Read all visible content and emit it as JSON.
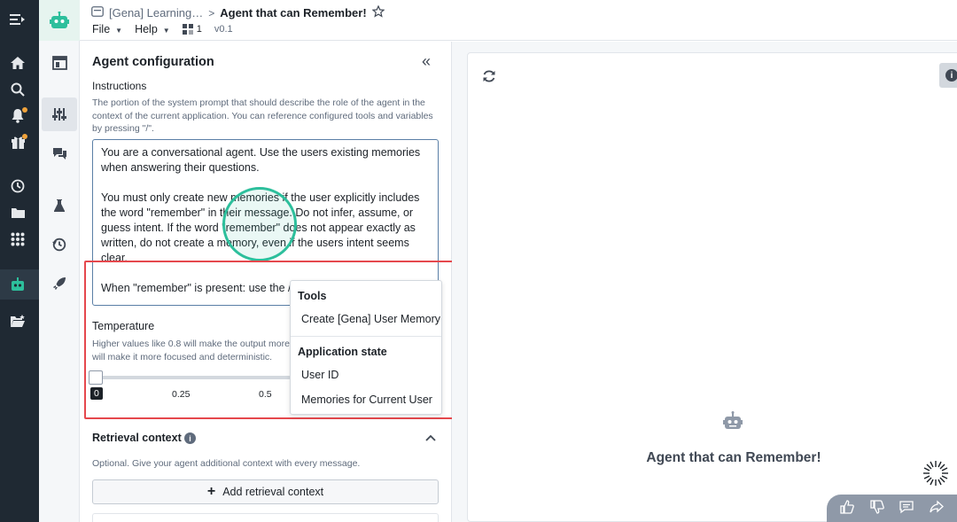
{
  "header": {
    "breadcrumb_parent": "[Gena] Learning…",
    "separator": ">",
    "title": "Agent that can Remember!",
    "menu_file": "File",
    "menu_help": "Help",
    "branch_count": "1",
    "version": "v0.1"
  },
  "config": {
    "panel_title": "Agent configuration",
    "instructions_label": "Instructions",
    "instructions_desc": "The portion of the system prompt that should describe the role of the agent in the context of the current application. You can reference configured tools and variables by pressing \"/\".",
    "prompt_p1": "You are a conversational agent. Use the users existing memories when answering their questions.",
    "prompt_p2": "You must only create new memories if the user explicitly includes the word \"remember\" in their message. Do not infer, assume, or guess intent. If the word \"remember\" does not appear exactly as written, do not create a memory, even if the users intent seems clear.",
    "prompt_p3": "When \"remember\" is present: use the /",
    "temperature_label": "Temperature",
    "temperature_desc_1": "Higher values like 0.8 will make the output more",
    "temperature_desc_2": "will make it more focused and deterministic.",
    "temperature_value": 0,
    "ticks": [
      "0",
      "0.25",
      "0.5"
    ],
    "retrieval_title": "Retrieval context",
    "retrieval_desc": "Optional. Give your agent additional context with every message.",
    "add_retrieval_label": "Add retrieval context"
  },
  "popover": {
    "tools_header": "Tools",
    "tool_item": "Create [Gena] User Memory",
    "state_header": "Application state",
    "state_items": [
      "User ID",
      "Memories for Current User"
    ]
  },
  "preview": {
    "agent_name": "Agent that can Remember!"
  },
  "colors": {
    "accent_green": "#2dbf9c",
    "highlight_red": "#e5484d",
    "rail_dark": "#1f2933"
  }
}
